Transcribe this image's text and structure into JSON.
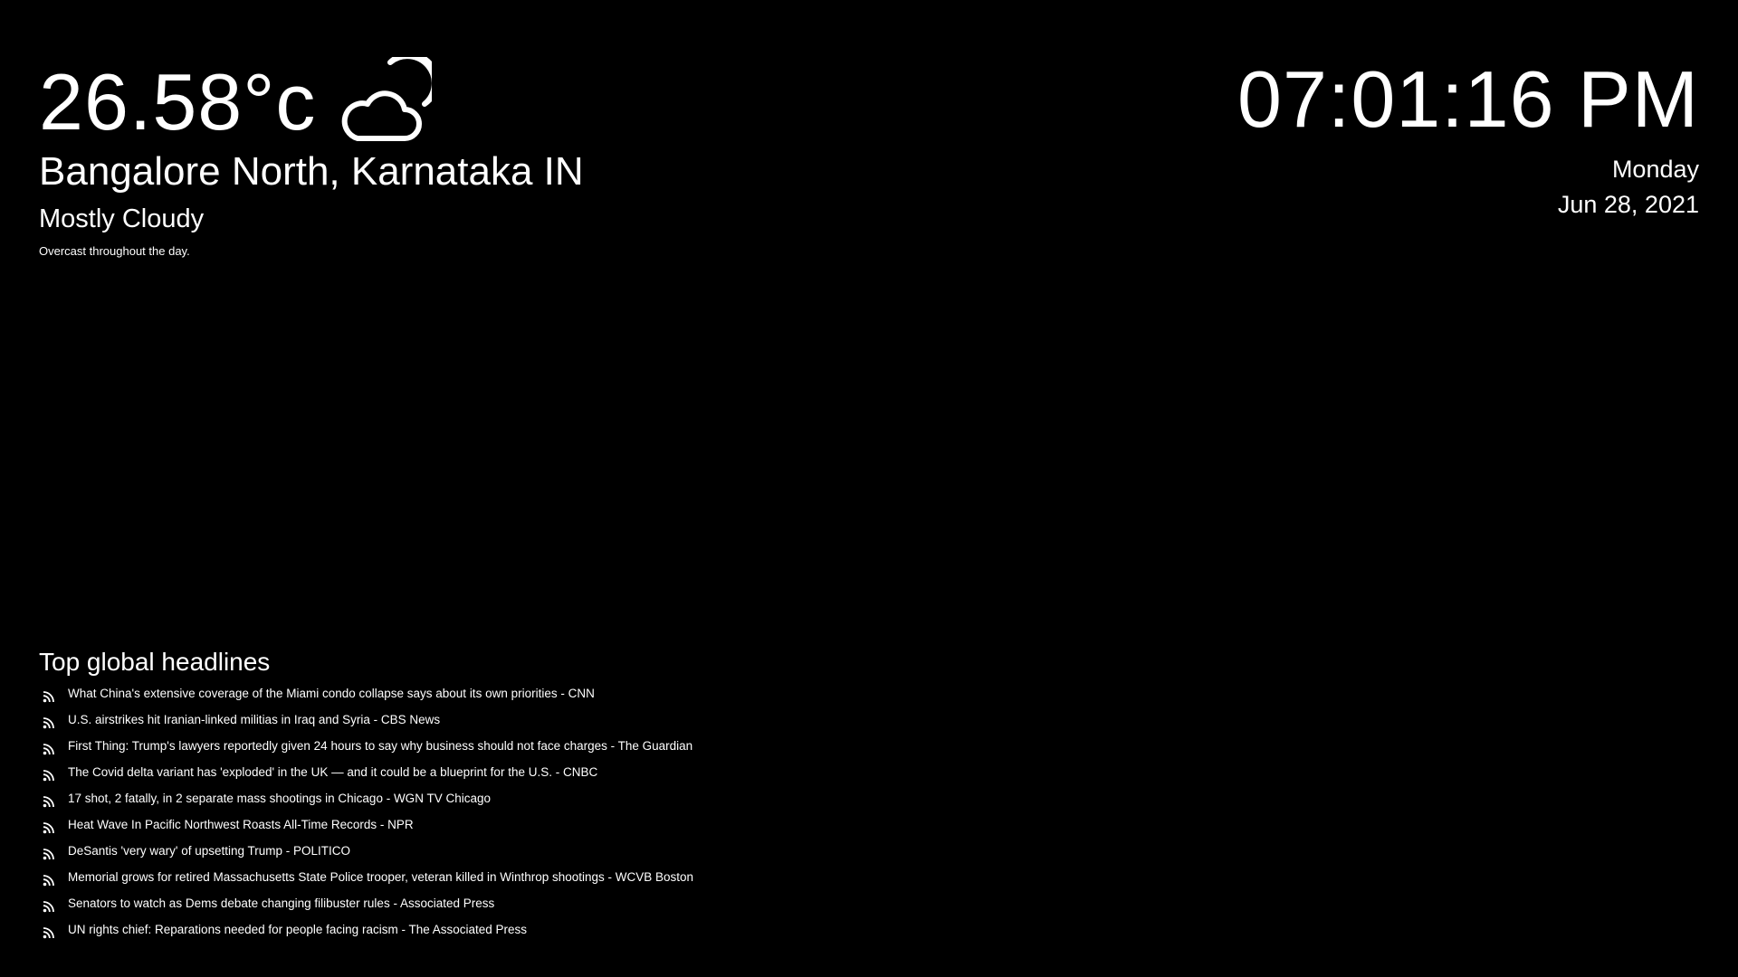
{
  "weather": {
    "temperature": "26.58°c",
    "icon": "partly-cloudy-night-icon",
    "location": "Bangalore North, Karnataka IN",
    "condition": "Mostly Cloudy",
    "summary": "Overcast throughout the day."
  },
  "clock": {
    "time": "07:01:16 PM",
    "day": "Monday",
    "date": "Jun 28, 2021"
  },
  "headlines": {
    "title": "Top global headlines",
    "icon": "rss-icon",
    "items": [
      {
        "text": "What China's extensive coverage of the Miami condo collapse says about its own priorities - CNN"
      },
      {
        "text": "U.S. airstrikes hit Iranian-linked militias in Iraq and Syria - CBS News"
      },
      {
        "text": "First Thing: Trump's lawyers reportedly given 24 hours to say why business should not face charges - The Guardian"
      },
      {
        "text": "The Covid delta variant has 'exploded' in the UK — and it could be a blueprint for the U.S. - CNBC"
      },
      {
        "text": "17 shot, 2 fatally, in 2 separate mass shootings in Chicago - WGN TV Chicago"
      },
      {
        "text": "Heat Wave In Pacific Northwest Roasts All-Time Records - NPR"
      },
      {
        "text": "DeSantis 'very wary' of upsetting Trump - POLITICO"
      },
      {
        "text": "Memorial grows for retired Massachusetts State Police trooper, veteran killed in Winthrop shootings - WCVB Boston"
      },
      {
        "text": "Senators to watch as Dems debate changing filibuster rules - Associated Press"
      },
      {
        "text": "UN rights chief: Reparations needed for people facing racism - The Associated Press"
      }
    ]
  },
  "colors": {
    "background": "#000000",
    "text": "#ffffff"
  }
}
